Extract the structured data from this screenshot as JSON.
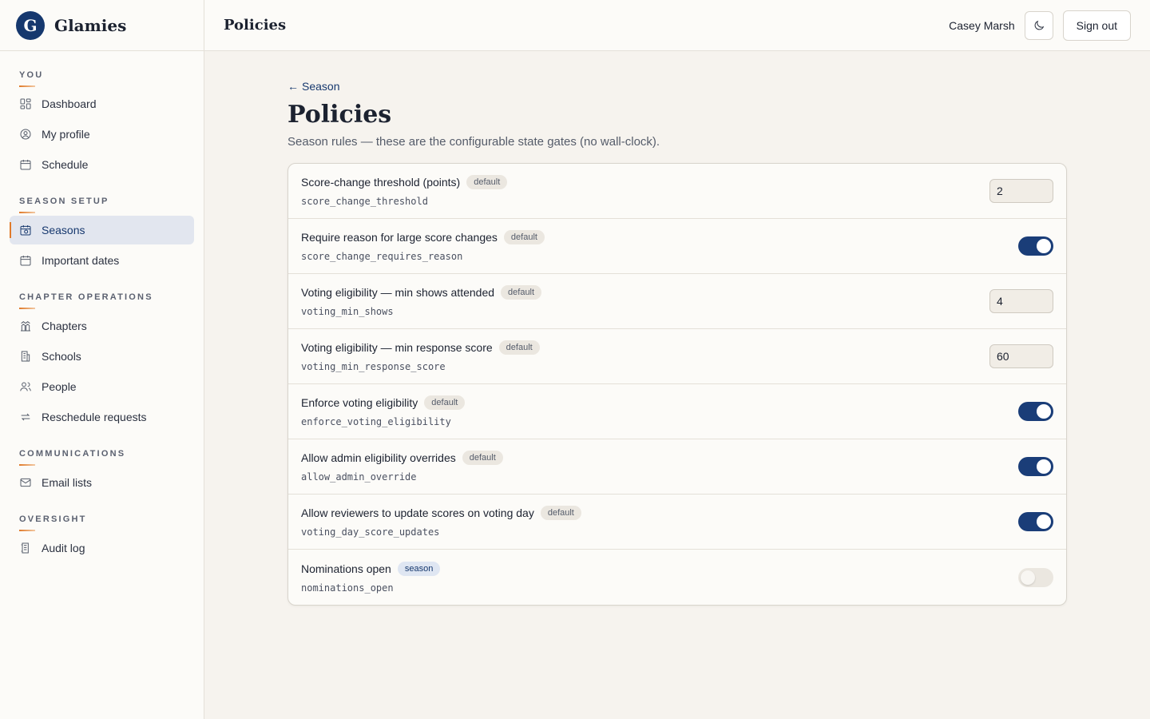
{
  "brand": {
    "name": "Glamies",
    "logo_letter": "G"
  },
  "header": {
    "title": "Policies",
    "user_name": "Casey Marsh",
    "theme_icon": "moon-icon",
    "sign_out_label": "Sign out"
  },
  "sidebar": {
    "sections": [
      {
        "label": "YOU",
        "items": [
          {
            "label": "Dashboard",
            "icon": "dashboard-icon"
          },
          {
            "label": "My profile",
            "icon": "user-circle-icon"
          },
          {
            "label": "Schedule",
            "icon": "calendar-icon"
          }
        ]
      },
      {
        "label": "SEASON SETUP",
        "items": [
          {
            "label": "Seasons",
            "icon": "calendar-clock-icon",
            "active": true
          },
          {
            "label": "Important dates",
            "icon": "calendar-icon"
          }
        ]
      },
      {
        "label": "CHAPTER OPERATIONS",
        "items": [
          {
            "label": "Chapters",
            "icon": "chapters-icon"
          },
          {
            "label": "Schools",
            "icon": "building-icon"
          },
          {
            "label": "People",
            "icon": "people-icon"
          },
          {
            "label": "Reschedule requests",
            "icon": "arrows-icon"
          }
        ]
      },
      {
        "label": "COMMUNICATIONS",
        "items": [
          {
            "label": "Email lists",
            "icon": "mail-icon"
          }
        ]
      },
      {
        "label": "OVERSIGHT",
        "items": [
          {
            "label": "Audit log",
            "icon": "log-icon"
          }
        ]
      }
    ]
  },
  "main": {
    "back_label": "Season",
    "title": "Policies",
    "subtitle": "Season rules — these are the configurable state gates (no wall-clock).",
    "policies": [
      {
        "title": "Score-change threshold (points)",
        "badge": "default",
        "key": "score_change_threshold",
        "type": "number",
        "value": "2"
      },
      {
        "title": "Require reason for large score changes",
        "badge": "default",
        "key": "score_change_requires_reason",
        "type": "toggle",
        "on": true
      },
      {
        "title": "Voting eligibility — min shows attended",
        "badge": "default",
        "key": "voting_min_shows",
        "type": "number",
        "value": "4"
      },
      {
        "title": "Voting eligibility — min response score",
        "badge": "default",
        "key": "voting_min_response_score",
        "type": "number",
        "value": "60"
      },
      {
        "title": "Enforce voting eligibility",
        "badge": "default",
        "key": "enforce_voting_eligibility",
        "type": "toggle",
        "on": true
      },
      {
        "title": "Allow admin eligibility overrides",
        "badge": "default",
        "key": "allow_admin_override",
        "type": "toggle",
        "on": true
      },
      {
        "title": "Allow reviewers to update scores on voting day",
        "badge": "default",
        "key": "voting_day_score_updates",
        "type": "toggle",
        "on": true
      },
      {
        "title": "Nominations open",
        "badge": "season",
        "key": "nominations_open",
        "type": "toggle",
        "on": false
      }
    ]
  },
  "colors": {
    "accent": "#16386e",
    "toggle_on": "#1a3d78",
    "highlight": "#e07a2a",
    "background": "#f6f3ee"
  }
}
